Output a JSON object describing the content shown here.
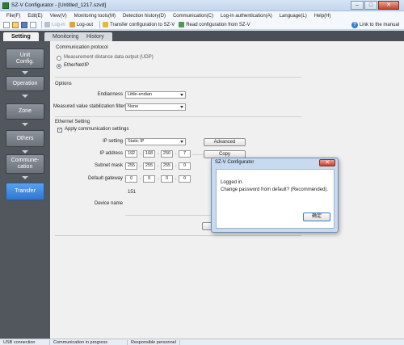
{
  "window": {
    "title": "SZ-V Configurator - [Untitled_1217.szvd]",
    "minimize": "–",
    "maximize": "□",
    "close": "✕"
  },
  "menu": [
    "File(F)",
    "Edit(E)",
    "View(V)",
    "Monitoring tools(M)",
    "Detection history(D)",
    "Communication(C)",
    "Log-in authentication(A)",
    "Language(L)",
    "Help(H)"
  ],
  "toolbar": {
    "login_label": "Log-in",
    "logout_label": "Log-out",
    "transfer_label": "Transfer configuration to SZ-V",
    "read_label": "Read configuration from SZ-V",
    "manual_label": "Link to the manual"
  },
  "tabs": [
    "Setting",
    "Monitoring",
    "History"
  ],
  "sidebar": {
    "items": [
      "Unit\nConfig.",
      "Operation",
      "Zone",
      "Others",
      "Commune-\ncation",
      "Transfer"
    ],
    "active": "Transfer"
  },
  "main": {
    "comm": {
      "title": "Communication protocol",
      "options": [
        "Measurement distance data output (UDP)",
        "EtherNet/IP"
      ],
      "selected": "EtherNet/IP"
    },
    "options": {
      "title": "Options",
      "endianness_label": "Endianness",
      "endianness_value": "Little-endian",
      "filter_label": "Measured value stabilization filter",
      "filter_value": "None"
    },
    "ethernet": {
      "title": "Ethernet Setting",
      "apply_label": "Apply communication settings",
      "apply_checked": "✓",
      "ip_setting_label": "IP setting",
      "ip_setting_value": "Static IP",
      "advanced_label": "Advanced",
      "ip_label": "IP address",
      "ip": [
        "192",
        "168",
        "250",
        "7"
      ],
      "copy_label": "Copy",
      "mask_label": "Subnet mask",
      "mask": [
        "255",
        "255",
        "255",
        "0"
      ],
      "gateway_label": "Default gateway",
      "gateway": [
        "0",
        "0",
        "0",
        "0"
      ],
      "value_151": "151",
      "device_name_label": "Device name"
    }
  },
  "dialog": {
    "title": "SZ-V Configurator",
    "line1": "Logged in.",
    "line2": "Change password from default? (Recommended).",
    "ok_label": "确定",
    "close": "✕"
  },
  "status": [
    "USB connection",
    "Communication in progress",
    "Responsible personnel"
  ]
}
